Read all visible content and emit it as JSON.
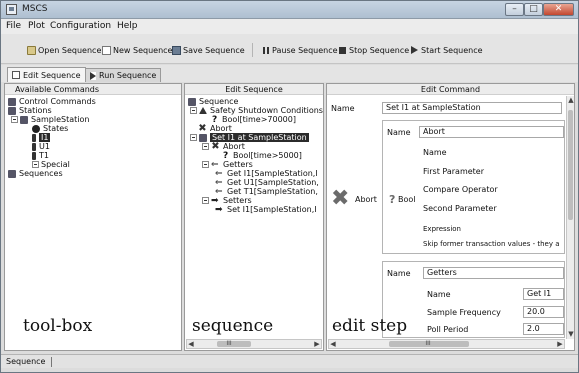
{
  "window": {
    "title": "MSCS",
    "buttons": {
      "minimize": "–",
      "maximize": "□",
      "close": "✕"
    }
  },
  "menu": [
    "File",
    "Plot",
    "Configuration",
    "Help"
  ],
  "toolbar": {
    "open": "Open Sequence",
    "new": "New Sequence",
    "save": "Save Sequence",
    "pause": "Pause Sequence",
    "stop": "Stop Sequence",
    "start": "Start Sequence"
  },
  "tabs": {
    "edit": "Edit Sequence",
    "run": "Run Sequence"
  },
  "toolbox": {
    "header": "Available Commands",
    "items": [
      "Control Commands",
      "Stations",
      "SampleStation",
      "States",
      "I1",
      "U1",
      "T1",
      "Special",
      "Sequences"
    ],
    "caption": "tool-box"
  },
  "sequence": {
    "header": "Edit Sequence",
    "items": [
      "Sequence",
      "Safety Shutdown Conditions",
      "Bool[time>70000]",
      "Abort",
      "Set I1 at SampleStation",
      "Abort",
      "Bool[time>5000]",
      "Getters",
      "Get I1[SampleStation,I",
      "Get U1[SampleStation,",
      "Get T1[SampleStation,",
      "Setters",
      "Set I1[SampleStation,I"
    ],
    "caption": "sequence",
    "scroll_label": "III"
  },
  "edit": {
    "header": "Edit Command",
    "name_label": "Name",
    "name_value": "Set I1 at SampleStation",
    "abort_label": "Abort",
    "abort_box": {
      "name_label": "Name",
      "name_value": "Abort",
      "bool_label": "Bool",
      "rows": [
        "Name",
        "First Parameter",
        "Compare Operator",
        "Second Parameter",
        "Expression",
        "Skip former transaction values - they a"
      ]
    },
    "getters_box": {
      "name_label": "Name",
      "name_value": "Getters",
      "rows": [
        {
          "label": "Name",
          "value": "Get I1"
        },
        {
          "label": "Sample Frequency",
          "value": "20.0"
        },
        {
          "label": "Poll Period",
          "value": "2.0"
        }
      ]
    },
    "caption": "edit step",
    "scroll_label": "III"
  },
  "status": {
    "text": "Sequence"
  },
  "colors": {
    "titlebar": "#aebfd1",
    "close_button": "#c2472f",
    "selection": "#2b2b2b"
  }
}
